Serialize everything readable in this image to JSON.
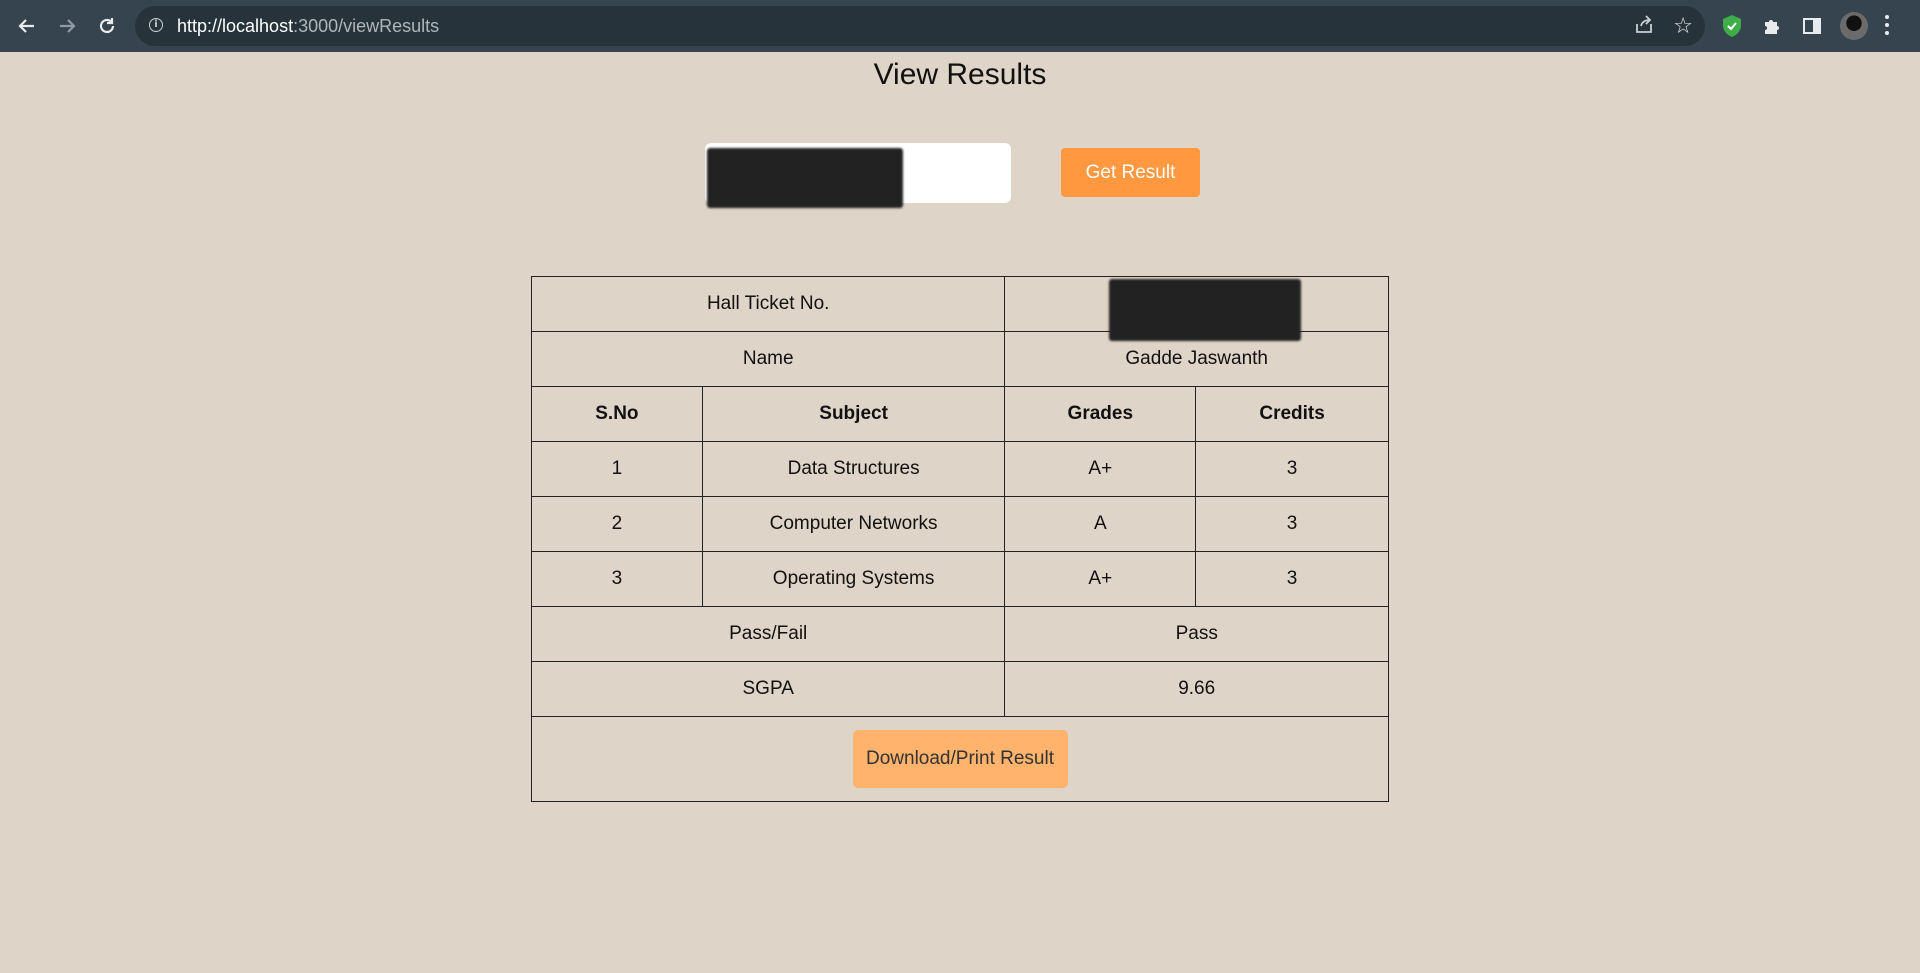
{
  "browser": {
    "url_host": "http://localhost",
    "url_path": ":3000/viewResults"
  },
  "page": {
    "title": "View Results"
  },
  "search": {
    "button_label": "Get Result"
  },
  "result": {
    "hall_ticket_label": "Hall Ticket No.",
    "name_label": "Name",
    "name_value": "Gadde Jaswanth",
    "columns": [
      "S.No",
      "Subject",
      "Grades",
      "Credits"
    ],
    "rows": [
      {
        "sno": "1",
        "subject": "Data Structures",
        "grade": "A+",
        "credits": "3"
      },
      {
        "sno": "2",
        "subject": "Computer Networks",
        "grade": "A",
        "credits": "3"
      },
      {
        "sno": "3",
        "subject": "Operating Systems",
        "grade": "A+",
        "credits": "3"
      }
    ],
    "pass_fail_label": "Pass/Fail",
    "pass_fail_value": "Pass",
    "sgpa_label": "SGPA",
    "sgpa_value": "9.66",
    "download_label": "Download/Print Result"
  },
  "colors": {
    "page_bg": "#dfd4c8",
    "browser_bar": "#35444e",
    "accent_button": "#ff983f",
    "download_button": "#ffb36d"
  }
}
